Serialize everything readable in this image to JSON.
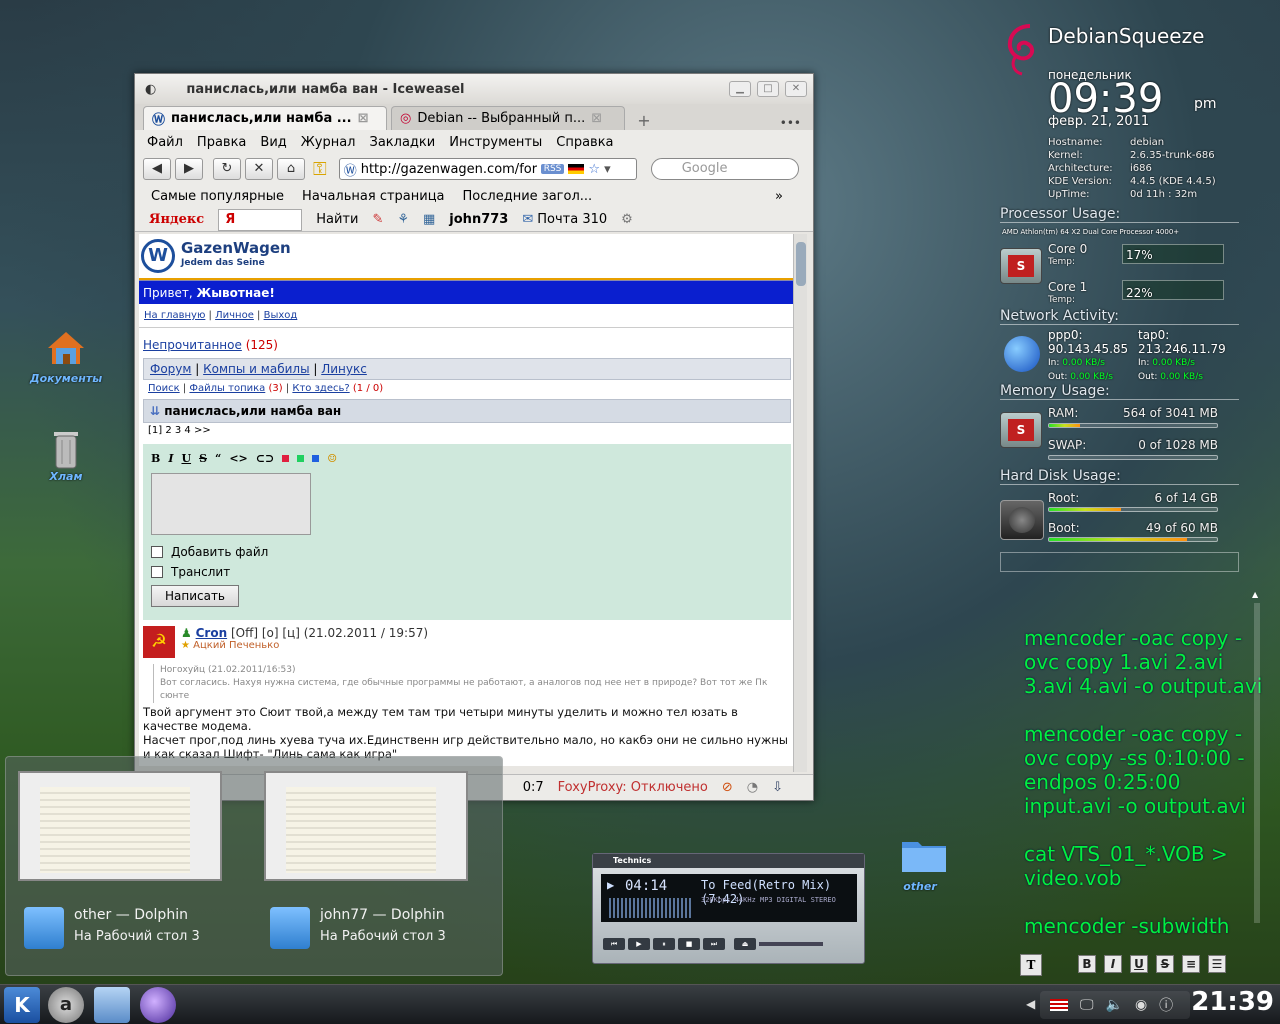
{
  "desktop": {
    "icons": [
      {
        "label": "Документы"
      },
      {
        "label": "Хлам"
      },
      {
        "label": "other"
      }
    ]
  },
  "browser": {
    "title": "панислась,или намба ван - Iceweasel",
    "tabs": [
      {
        "label": "панислась,или намба ..."
      },
      {
        "label": "Debian -- Выбранный п..."
      }
    ],
    "menu": [
      "Файл",
      "Правка",
      "Вид",
      "Журнал",
      "Закладки",
      "Инструменты",
      "Справка"
    ],
    "url": "http://gazenwagen.com/for",
    "rss": "RSS",
    "search_placeholder": "Google",
    "bookmarks": [
      "Самые популярные",
      "Начальная страница",
      "Последние загол..."
    ],
    "yandex": {
      "logo": "Яндекс",
      "input": "Я",
      "find": "Найти",
      "user": "john773",
      "mail": "Почта 310"
    },
    "status": {
      "time": "0:7",
      "foxy": "FoxyProxy: Отключено"
    }
  },
  "page": {
    "site_name": "GazenWagen",
    "site_tagline": "Jedem das Seine",
    "greeting_prefix": "Привет, ",
    "greeting_user": "Жывотнае!",
    "top_links": [
      "На главную",
      "Личное",
      "Выход"
    ],
    "unread_label": "Непрочитанное",
    "unread_count": "(125)",
    "forum_links": [
      "Форум",
      "Компы и мабилы",
      "Линукс"
    ],
    "sub_links": {
      "search": "Поиск",
      "files": "Файлы топика",
      "files_count": "(3)",
      "who": "Кто здесь?",
      "who_count": "(1 / 0)"
    },
    "topic_title": "панислась,или намба ван",
    "pages": "[1] 2 3 4 >>",
    "reply": {
      "add_file": "Добавить файл",
      "translit": "Транслит",
      "submit": "Написать"
    },
    "post": {
      "author": "Cron",
      "meta": "[Off] [о] [ц] (21.02.2011 / 19:57)",
      "rank": "Ацкий Печенько",
      "quote_header": "Ногохуйц (21.02.2011/16:53)",
      "quote_text": "Вот согласись. Нахуя нужна система, где обычные программы не работают, а аналогов под нее нет в природе? Вот тот же Пк сюнте",
      "body": "Твой аргумент это Сюит твой,а между тем там три четыри минуты уделить и можно тел юзать в качестве модема.\nНасчет прог,под линь хуева туча их.Единственн игр действительно мало, но какбэ они не сильно нужны и как сказал Шифт- \"Линь сама как игра\""
    }
  },
  "task_preview": [
    {
      "title": "other — Dolphin",
      "desktop": "На Рабочий стол 3"
    },
    {
      "title": "john77 — Dolphin",
      "desktop": "На Рабочий стол 3"
    }
  ],
  "player": {
    "brand": "Technics",
    "time": "04:14",
    "track": "To Feed(Retro Mix) (7:42)",
    "info": "320Kbps 44KHz MP3 DIGITAL STEREO"
  },
  "conky": {
    "distro": "DebianSqueeze",
    "weekday": "понедельник",
    "time": "09:39",
    "ampm": "pm",
    "date": "февр. 21, 2011",
    "sys": [
      {
        "k": "Hostname:",
        "v": "debian"
      },
      {
        "k": "Kernel:",
        "v": "2.6.35-trunk-686"
      },
      {
        "k": "Architecture:",
        "v": "i686"
      },
      {
        "k": "KDE Version:",
        "v": "4.4.5 (KDE 4.4.5)"
      },
      {
        "k": "UpTime:",
        "v": "0d 11h : 32m"
      }
    ],
    "cpu_head": "Processor Usage:",
    "cpu_model": "AMD Athlon(tm) 64 X2 Dual Core Processor 4000+",
    "cores": [
      {
        "label": "Core 0",
        "temp": "Temp:",
        "pct": "17%"
      },
      {
        "label": "Core 1",
        "temp": "Temp:",
        "pct": "22%"
      }
    ],
    "net_head": "Network Activity:",
    "net": [
      {
        "iface": "ppp0:",
        "ip": "90.143.45.85",
        "in": "0.00 KB/s",
        "out": "0.00 KB/s"
      },
      {
        "iface": "tap0:",
        "ip": "213.246.11.79",
        "in": "0.00 KB/s",
        "out": "0.00 KB/s"
      }
    ],
    "in_label": "In:",
    "out_label": "Out:",
    "mem_head": "Memory Usage:",
    "ram_label": "RAM:",
    "ram_value": "564 of 3041 MB",
    "ram_fraction": 0.185,
    "swap_label": "SWAP:",
    "swap_value": "0 of 1028 MB",
    "swap_fraction": 0.0,
    "disk_head": "Hard Disk Usage:",
    "root_label": "Root:",
    "root_value": "6 of 14 GB",
    "root_fraction": 0.43,
    "boot_label": "Boot:",
    "boot_value": "49 of 60 MB",
    "boot_fraction": 0.82
  },
  "terminal_notes": [
    "mencoder -oac copy -ovc copy 1.avi 2.avi 3.avi 4.avi -o output.avi",
    "mencoder -oac copy -ovc copy -ss 0:10:00 -endpos 0:25:00 input.avi -o output.avi",
    "cat VTS_01_*.VOB > video.vob",
    "mencoder -subwidth"
  ],
  "panel": {
    "clock": "21:39"
  }
}
